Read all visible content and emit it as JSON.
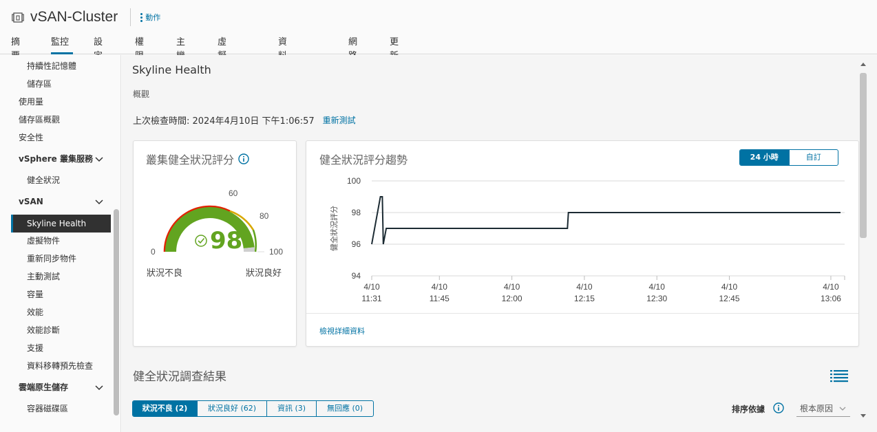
{
  "header": {
    "title": "vSAN-Cluster",
    "actions_label": "動作",
    "tabs": [
      "摘要",
      "監控",
      "設定",
      "權限",
      "主機",
      "虛擬機器",
      "資料存放區",
      "網路",
      "更新"
    ],
    "active_tab": "監控"
  },
  "sidebar": {
    "items": [
      {
        "label": "持續性記憶體"
      },
      {
        "label": "儲存區"
      },
      {
        "label": "使用量"
      },
      {
        "label": "儲存區概觀"
      },
      {
        "label": "安全性"
      },
      {
        "label": "vSphere 叢集服務"
      },
      {
        "label": "健全狀況"
      },
      {
        "label": "vSAN"
      },
      {
        "label": "Skyline Health"
      },
      {
        "label": "虛擬物件"
      },
      {
        "label": "重新同步物件"
      },
      {
        "label": "主動測試"
      },
      {
        "label": "容量"
      },
      {
        "label": "效能"
      },
      {
        "label": "效能診斷"
      },
      {
        "label": "支援"
      },
      {
        "label": "資料移轉預先檢查"
      },
      {
        "label": "雲端原生儲存"
      },
      {
        "label": "容器磁碟區"
      }
    ]
  },
  "main": {
    "title": "Skyline Health",
    "overview": "概觀",
    "last_check_label": "上次檢查時間: 2024年4月10日 下午1:06:57",
    "retest_label": "重新測試",
    "score_card": {
      "title": "叢集健全狀況評分",
      "score": "98",
      "gauge_labels": [
        "0",
        "60",
        "80",
        "100"
      ],
      "bad_label": "狀況不良",
      "good_label": "狀況良好"
    },
    "trend_card": {
      "title": "健全狀況評分趨勢",
      "range_options": [
        "24 小時",
        "自訂"
      ],
      "active_range": "24 小時",
      "details_link": "檢視詳細資料"
    },
    "findings": {
      "title": "健全狀況調查結果",
      "filters": [
        "狀況不良 (2)",
        "狀況良好 (62)",
        "資訊 (3)",
        "無回應 (0)"
      ],
      "active_filter": "狀況不良 (2)",
      "sort_label": "排序依據",
      "sort_value": "根本原因"
    }
  },
  "chart_data": {
    "type": "line",
    "title": "",
    "ylabel": "健全狀況評分",
    "xlabel": "",
    "ylim": [
      94,
      100
    ],
    "yticks": [
      100,
      98,
      96,
      94
    ],
    "x_tick_labels": [
      [
        "4/10",
        "11:31"
      ],
      [
        "4/10",
        "11:45"
      ],
      [
        "4/10",
        "12:00"
      ],
      [
        "4/10",
        "12:15"
      ],
      [
        "4/10",
        "12:30"
      ],
      [
        "4/10",
        "12:45"
      ],
      [
        "4/10",
        "13:06"
      ]
    ],
    "x_minutes": [
      0,
      14,
      29,
      44,
      59,
      74,
      95
    ],
    "series": [
      {
        "points": [
          [
            0,
            96
          ],
          [
            1.8,
            99
          ],
          [
            2.2,
            99
          ],
          [
            2.4,
            96
          ],
          [
            3.0,
            97
          ],
          [
            40.5,
            97
          ],
          [
            40.7,
            98
          ],
          [
            97,
            98
          ]
        ]
      }
    ],
    "grid": true
  },
  "colors": {
    "accent": "#0072a3",
    "gauge_green": "#62a420",
    "gauge_red": "#e12200",
    "gauge_yellow": "#d8a800"
  }
}
